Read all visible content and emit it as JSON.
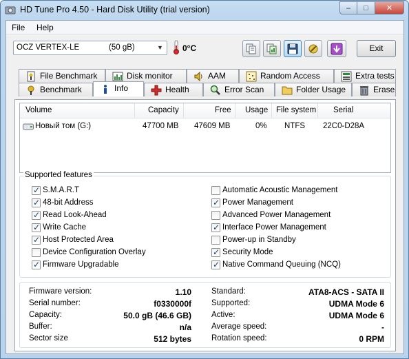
{
  "window": {
    "title": "HD Tune Pro 4.50 - Hard Disk Utility (trial version)",
    "min_label": "–",
    "max_label": "□",
    "close_label": "✕"
  },
  "menu": {
    "file": "File",
    "help": "Help"
  },
  "toolbar": {
    "drive_name": "OCZ VERTEX-LE",
    "drive_size": "(50 gB)",
    "temperature": "0°C",
    "exit_label": "Exit"
  },
  "tabs_top": [
    "File Benchmark",
    "Disk monitor",
    "AAM",
    "Random Access",
    "Extra tests"
  ],
  "tabs_bottom": [
    "Benchmark",
    "Info",
    "Health",
    "Error Scan",
    "Folder Usage",
    "Erase"
  ],
  "active_tab": "Info",
  "volumes": {
    "headers": [
      "Volume",
      "Capacity",
      "Free",
      "Usage",
      "File system",
      "Serial"
    ],
    "rows": [
      {
        "volume": "Новый том (G:)",
        "capacity": "47700 MB",
        "free": "47609 MB",
        "usage": "0%",
        "fs": "NTFS",
        "serial": "22C0-D28A"
      }
    ]
  },
  "features": {
    "title": "Supported features",
    "left": [
      {
        "label": "S.M.A.R.T",
        "checked": true
      },
      {
        "label": "48-bit Address",
        "checked": true
      },
      {
        "label": "Read Look-Ahead",
        "checked": true
      },
      {
        "label": "Write Cache",
        "checked": true
      },
      {
        "label": "Host Protected Area",
        "checked": true
      },
      {
        "label": "Device Configuration Overlay",
        "checked": false
      },
      {
        "label": "Firmware Upgradable",
        "checked": true
      }
    ],
    "right": [
      {
        "label": "Automatic Acoustic Management",
        "checked": false
      },
      {
        "label": "Power Management",
        "checked": true
      },
      {
        "label": "Advanced Power Management",
        "checked": false
      },
      {
        "label": "Interface Power Management",
        "checked": true
      },
      {
        "label": "Power-up in Standby",
        "checked": false
      },
      {
        "label": "Security Mode",
        "checked": true
      },
      {
        "label": "Native Command Queuing (NCQ)",
        "checked": true
      }
    ]
  },
  "info": {
    "left": [
      {
        "key": "Firmware version:",
        "value": "1.10"
      },
      {
        "key": "Serial number:",
        "value": "f0330000f"
      },
      {
        "key": "Capacity:",
        "value": "50.0 gB (46.6 GB)"
      },
      {
        "key": "Buffer:",
        "value": "n/a"
      },
      {
        "key": "Sector size",
        "value": "512 bytes"
      }
    ],
    "right": [
      {
        "key": "Standard:",
        "value": "ATA8-ACS - SATA II"
      },
      {
        "key": "Supported:",
        "value": "UDMA Mode 6"
      },
      {
        "key": "Active:",
        "value": "UDMA Mode 6"
      },
      {
        "key": "Average speed:",
        "value": "-"
      },
      {
        "key": "Rotation speed:",
        "value": "0 RPM"
      }
    ]
  }
}
